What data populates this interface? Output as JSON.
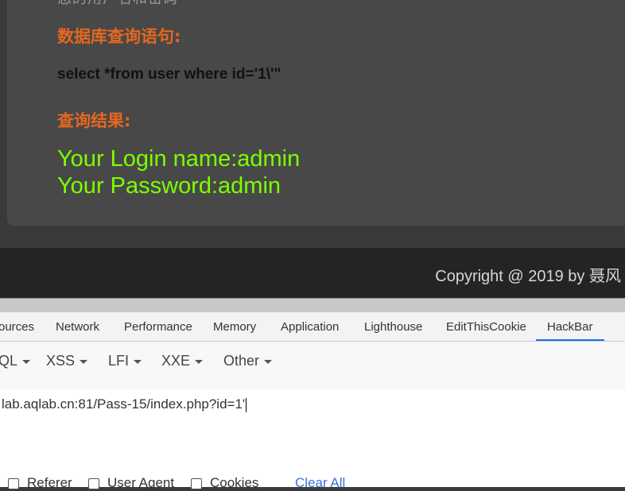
{
  "page": {
    "cut_text": "您的用户名和密码",
    "db_label": "数据库查询语句:",
    "sql": "select *from user where id='1\\'\"",
    "result_label": "查询结果:",
    "result_line1": "Your Login name:admin",
    "result_line2": "Your Password:admin",
    "copyright": "Copyright @ 2019 by 聂风"
  },
  "devtools": {
    "tabs": [
      "ources",
      "Network",
      "Performance",
      "Memory",
      "Application",
      "Lighthouse",
      "EditThisCookie",
      "HackBar"
    ],
    "active_tab": "HackBar"
  },
  "hackbar": {
    "menus": [
      "QL",
      "XSS",
      "LFI",
      "XXE",
      "Other"
    ],
    "url": "lab.aqlab.cn:81/Pass-15/index.php?id=1'",
    "checkboxes": [
      "Referer",
      "User Agent",
      "Cookies"
    ],
    "clear_all": "Clear All"
  }
}
